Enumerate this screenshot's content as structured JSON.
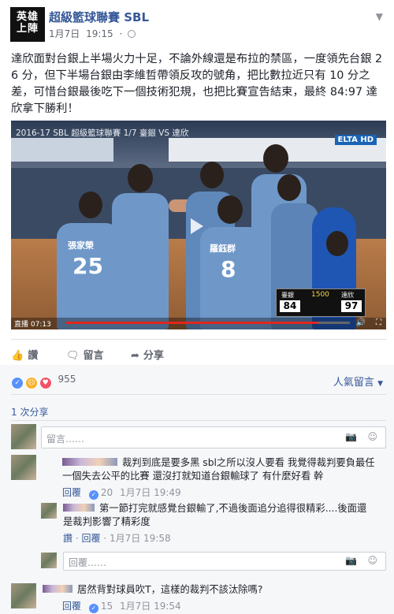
{
  "header": {
    "logo_text": "英雄上陣",
    "page_name": "超級籃球聯賽 SBL",
    "date": "1月7日",
    "time": "19:15",
    "privacy_icon": "globe-icon",
    "more_icon": "chevron-down-icon"
  },
  "post": {
    "text": "達欣面對台銀上半場火力十足，不論外線還是布拉的禁區，一度領先台銀 26 分，但下半場台銀由李維哲帶領反攻的號角，把比數拉近只有 10 分之差，可惜台銀最後吃下一個技術犯規，也把比賽宣告結束，最終 84:97 達欣拿下勝利！"
  },
  "video": {
    "title": "2016-17 SBL 超級籃球聯賽 1/7 臺銀 VS 達欣",
    "broadcaster": "ELTA HD",
    "jerseys": [
      {
        "name": "張家榮",
        "number": "25"
      },
      {
        "name": "羅鈺群",
        "number": "8"
      }
    ],
    "scoreboard": {
      "team_left": "臺銀",
      "team_right": "達欣",
      "clock": "1500",
      "score_left": "84",
      "score_right": "97"
    },
    "live_label": "直播",
    "timestamp": "07:13",
    "progress": 0.89
  },
  "actions": {
    "like": "讚",
    "comment": "留言",
    "share": "分享"
  },
  "reactions": {
    "count": "955",
    "top_comments_label": "人氣留言",
    "shares": "1 次分享"
  },
  "composer": {
    "placeholder": "留言……"
  },
  "comments": [
    {
      "text": "裁判到底是要多黑 sbl之所以沒人要看 我覺得裁判要負最任 一個失去公平的比賽 還沒打就知道台銀輸球了 有什麼好看 幹",
      "action": "回覆",
      "likes": "20",
      "date": "1月7日",
      "time": "19:49"
    },
    {
      "text": "第一節打完就感覺台銀輸了,不過後面追分追得很精彩....後面還是裁判影響了精彩度",
      "like_label": "讚",
      "action": "回覆",
      "date": "1月7日",
      "time": "19:58"
    },
    {
      "text": "居然背對球員吹T，這樣的裁判不該汰除嗎?",
      "action": "回覆",
      "likes": "15",
      "date": "1月7日",
      "time": "19:54"
    }
  ],
  "reply_composer": {
    "placeholder": "回覆……"
  },
  "colors": {
    "link": "#365899",
    "muted": "#90949c",
    "like_blue": "#5890ff",
    "progress_red": "#e1261c"
  }
}
